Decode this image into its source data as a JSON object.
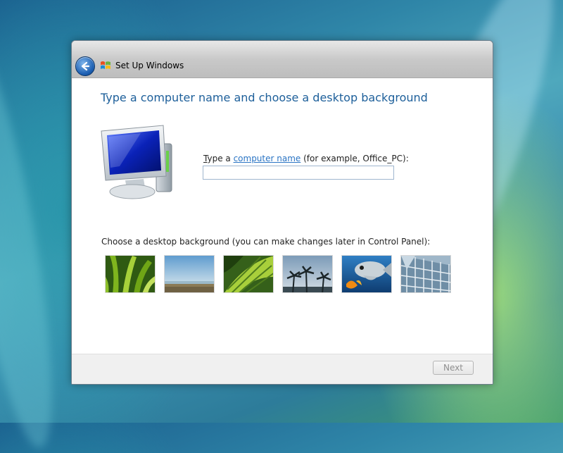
{
  "window": {
    "title": "Set Up Windows"
  },
  "page": {
    "heading": "Type a computer name and choose a desktop background",
    "name_label_prefix_underlined": "T",
    "name_label_prefix": "ype a ",
    "name_label_link": "computer name",
    "name_label_suffix": " (for example, Office_PC):",
    "name_input_value": "",
    "background_label": "Choose a desktop background (you can make changes later in Control Panel):",
    "backgrounds": [
      {
        "name": "green-leaves",
        "icon": "grass-leaves-image"
      },
      {
        "name": "beach",
        "icon": "beach-horizon-image"
      },
      {
        "name": "green-leaf-closeup",
        "icon": "leaf-closeup-image"
      },
      {
        "name": "palm-trees",
        "icon": "palm-trees-image"
      },
      {
        "name": "tropical-fish",
        "icon": "fish-image"
      },
      {
        "name": "glass-building",
        "icon": "building-glass-image"
      }
    ]
  },
  "footer": {
    "next_label": "Next"
  },
  "colors": {
    "heading": "#1d5f9a",
    "link": "#2a74c4",
    "accent": "#1d5fb2"
  },
  "icons": {
    "back": "back-arrow-icon",
    "logo": "windows-logo-icon",
    "computer": "computer-monitor-icon"
  }
}
